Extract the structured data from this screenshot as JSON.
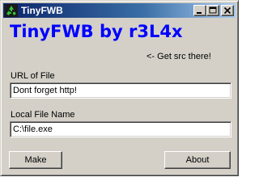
{
  "window": {
    "title": "TinyFWB",
    "icon": "recycle-icon",
    "controls": [
      "minimize",
      "maximize",
      "close"
    ]
  },
  "main": {
    "heading": "TinyFWB by r3L4x",
    "src_note": "<- Get src there!",
    "url_label": "URL of File",
    "url_value": "Dont forget http!",
    "local_label": "Local File Name",
    "local_value": "C:\\file.exe"
  },
  "buttons": {
    "make": "Make",
    "about": "About"
  },
  "colors": {
    "heading": "#0000ff",
    "titlebar_start": "#0a246a",
    "titlebar_end": "#a6caf0",
    "face": "#d4d0c8"
  }
}
